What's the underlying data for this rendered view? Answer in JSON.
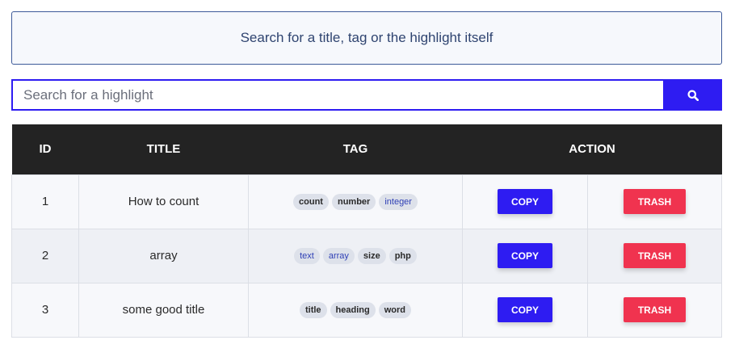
{
  "info": {
    "text": "Search for a title, tag or the highlight itself"
  },
  "search": {
    "placeholder": "Search for a highlight",
    "value": ""
  },
  "table": {
    "headers": {
      "id": "ID",
      "title": "TITLE",
      "tag": "TAG",
      "action": "ACTION"
    },
    "rows": [
      {
        "id": "1",
        "title": "How to count",
        "tags": [
          {
            "label": "count",
            "style": "bold"
          },
          {
            "label": "number",
            "style": "bold"
          },
          {
            "label": "integer",
            "style": "blue"
          }
        ],
        "copy": "COPY",
        "trash": "TRASH"
      },
      {
        "id": "2",
        "title": "array",
        "tags": [
          {
            "label": "text",
            "style": "blue"
          },
          {
            "label": "array",
            "style": "blue"
          },
          {
            "label": "size",
            "style": "bold"
          },
          {
            "label": "php",
            "style": "bold"
          }
        ],
        "copy": "COPY",
        "trash": "TRASH"
      },
      {
        "id": "3",
        "title": "some good title",
        "tags": [
          {
            "label": "title",
            "style": "bold"
          },
          {
            "label": "heading",
            "style": "bold"
          },
          {
            "label": "word",
            "style": "bold"
          }
        ],
        "copy": "COPY",
        "trash": "TRASH"
      }
    ]
  },
  "colors": {
    "primary": "#2e1cf2",
    "danger": "#f0334f",
    "header_bg": "#232323"
  },
  "icons": {
    "search": "search-icon"
  }
}
